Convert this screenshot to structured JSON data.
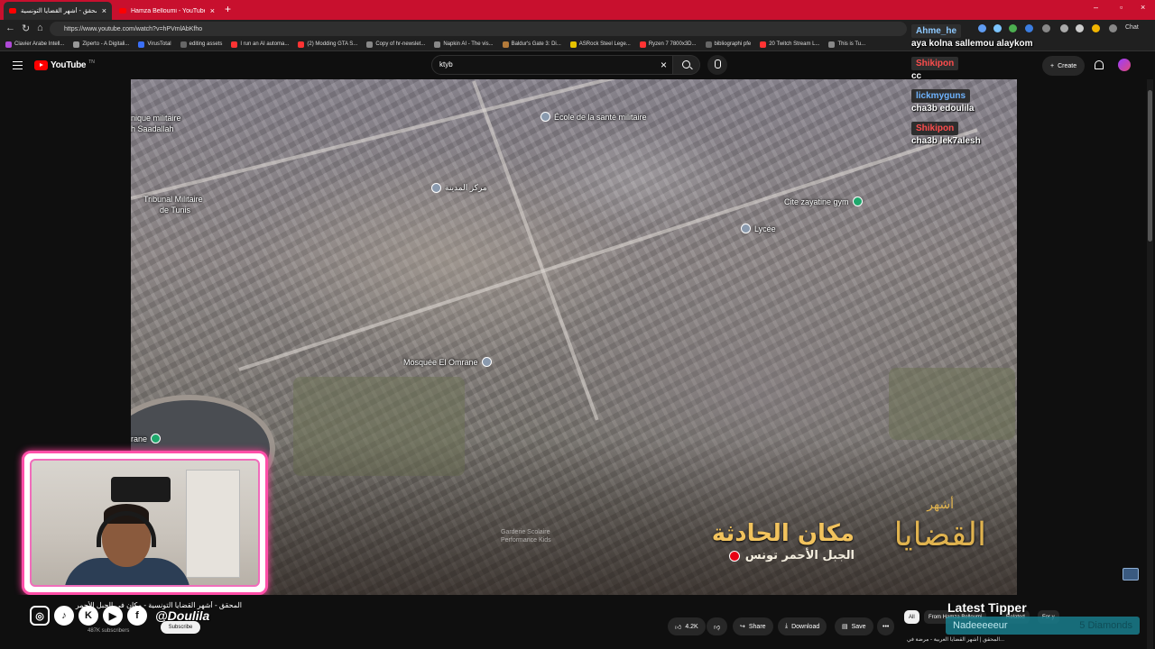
{
  "tabs": [
    {
      "title": "المحقق - أشهر القضايا التونسية - ..",
      "active": true
    },
    {
      "title": "Hamza Belloumi - YouTube",
      "active": false
    }
  ],
  "address": {
    "url": "https://www.youtube.com/watch?v=hPVmlAbKfho"
  },
  "bookmarks": [
    "Clavier Arabe Intell...",
    "Ziperto - A Digitali...",
    "VirusTotal",
    "editing assets",
    "I run an AI automa...",
    "(2) Modding GTA S...",
    "Copy of hr-newslet...",
    "Napkin AI - The vis...",
    "Baldur's Gate 3: Di...",
    "ASRock Steel Lege...",
    "Ryzen 7 7800x3D...",
    "bibliographi pfe",
    "20 Twitch Stream L...",
    "This is Tu..."
  ],
  "browser_chat_label": "Chat",
  "youtube": {
    "logo_text": "YouTube",
    "logo_country": "TN",
    "search_value": "ktyb",
    "create_label": "Create"
  },
  "map_labels": [
    "nique militaire",
    "h Saadallah",
    "École de la santé militaire",
    "Tribunal Militaire",
    "de Tunis",
    "مركز المدينة",
    "Cite zayatine gym",
    "Lycée",
    "Mosquée El Omrane",
    "rane",
    "Garderie Scolaire",
    "Performance Kids"
  ],
  "overlay": {
    "title_ar": "مكان الحادثة",
    "subtitle_ar": "الجبل الأحمر تونس",
    "logo_ar": "القضايا",
    "logo_small_ar": "أشهر"
  },
  "chat": [
    {
      "user": "Ahme_he",
      "user_color": "#8ec9ff",
      "text": "aya kolna sallemou alaykom"
    },
    {
      "user": "Shikipon",
      "user_color": "#ff4d4d",
      "text": "cc"
    },
    {
      "user": "lickmyguns",
      "user_color": "#6fb4ff",
      "text": "cha3b edoulila"
    },
    {
      "user": "Shikipon",
      "user_color": "#ff4d4d",
      "text": "cha3b lek7alesh"
    }
  ],
  "video_info": {
    "title": "المحقق - أشهر القضايا التونسية - مكان في الجبل الأحمر",
    "channel": "Hamza Belloumi",
    "subscribers": "487K subscribers",
    "subscribe_label": "Subscribe",
    "likes": "4.2K",
    "share_label": "Share",
    "download_label": "Download",
    "save_label": "Save",
    "more_label": "•••"
  },
  "social": {
    "handle": "@Doulila"
  },
  "chips": [
    "All",
    "From Hamza Belloumi",
    "Related",
    "For y"
  ],
  "tipper": {
    "title": "Latest Tipper",
    "name": "Nadeeeeeur",
    "amount": "5 Diamonds"
  },
  "thumb_strip_text": "المحقق | أشهر القضايا العربية - مرضة في..."
}
